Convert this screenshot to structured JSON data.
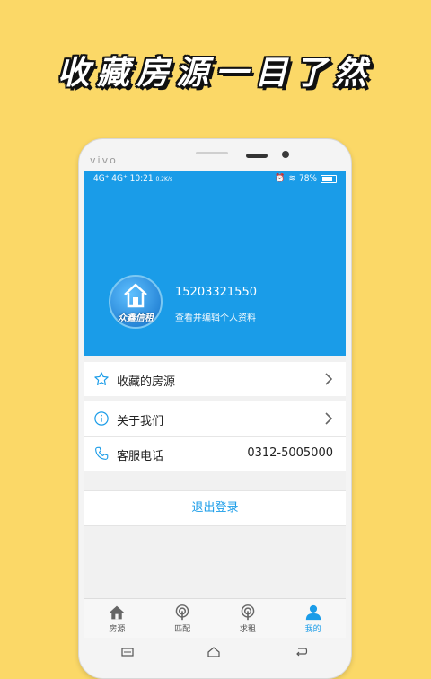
{
  "headline": "收藏房源一目了然",
  "device": {
    "brand": "vivo"
  },
  "statusbar": {
    "signal": "4G⁺ 4G⁺",
    "time": "10:21",
    "speed": "0.2K/s",
    "battery": "78%"
  },
  "profile": {
    "avatar_text": "众鑫信租",
    "phone": "15203321550",
    "edit_link": "查看并编辑个人资料"
  },
  "menu": {
    "favorites_label": "收藏的房源",
    "about_label": "关于我们",
    "service_label": "客服电话",
    "service_phone": "0312-5005000"
  },
  "logout_label": "退出登录",
  "tabs": [
    {
      "label": "房源",
      "icon": "house-icon"
    },
    {
      "label": "匹配",
      "icon": "radar-icon"
    },
    {
      "label": "求租",
      "icon": "radar-icon"
    },
    {
      "label": "我的",
      "icon": "user-icon"
    }
  ],
  "colors": {
    "background": "#FBD867",
    "primary": "#1A9CE8"
  }
}
